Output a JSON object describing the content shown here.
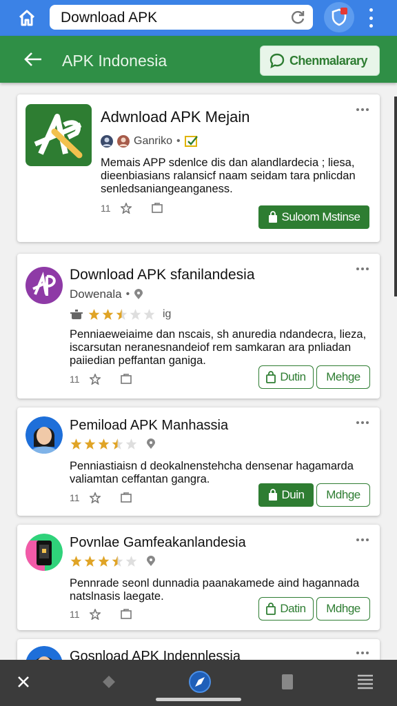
{
  "browser": {
    "url": "Download APK"
  },
  "header": {
    "title": "APK Indonesia",
    "action_label": "Chenmalarary"
  },
  "cards": [
    {
      "title": "Adwnload APK Mejain",
      "author": "Ganriko",
      "desc_lines": [
        "Memais APP sdenlce dis dan alandlardecia ; liesa,",
        "dieenbiasians ralansicf naam seidam tara pnlicdan",
        "senledsaniangeanganess."
      ],
      "count": "11",
      "button_label": "Suloom Mstinse",
      "brand_color": "#2e7d32"
    },
    {
      "title": "Download APK sfanilandesia",
      "author": "Dowenala",
      "rating_suffix": "ig",
      "rating": 2.5,
      "desc_lines": [
        "Penniaeweiaime dan nscais, sh anuredia ndandecra, lieza,",
        "iscarsutan neranesnandeiof rem samkaran ara pnliadan",
        "paiiedian peffantan ganiga."
      ],
      "count": "11",
      "button1_label": "Dutin",
      "button2_label": "Mehge"
    },
    {
      "title": "Pemiload APK Manhassia",
      "rating": 3.5,
      "desc_lines": [
        "Penniastiaisn d deokalnenstehcha densenar hagamarda",
        "valiamtan ceffantan gangra."
      ],
      "count": "11",
      "button1_label": "Duin",
      "button2_label": "Mdhge"
    },
    {
      "title": "Povnlae Gamfeakanlandesia",
      "rating": 3.5,
      "desc_lines": [
        "Pennrade seonl dunnadia paanakamede aind hagannada",
        "natslnasis laegate."
      ],
      "count": "11",
      "button1_label": "Datin",
      "button2_label": "Mdhge"
    },
    {
      "title": "Gosnload APK Indennlessia"
    }
  ]
}
